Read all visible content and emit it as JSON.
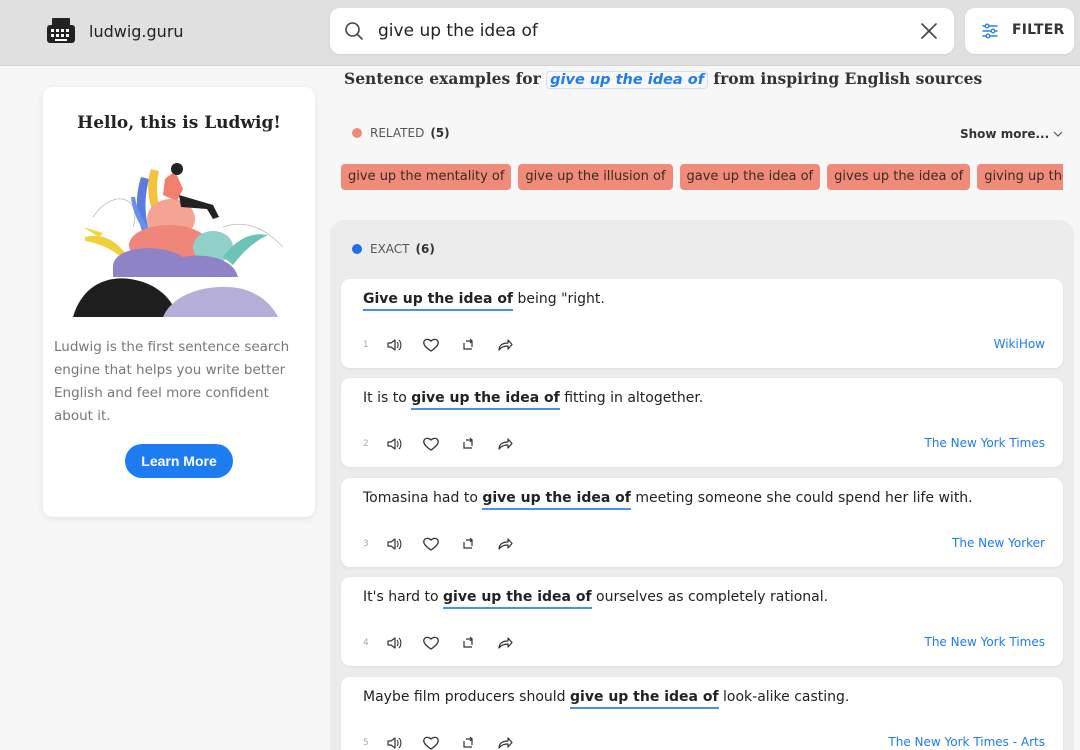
{
  "header": {
    "site_name": "ludwig.guru",
    "search_value": "give up the idea of",
    "filter_label": "FILTER"
  },
  "hello": {
    "title": "Hello, this is Ludwig!",
    "description": "Ludwig is the first sentence search engine that helps you write better English and feel more confident about it.",
    "button": "Learn More"
  },
  "heading": {
    "prefix": "Sentence examples for",
    "query": "give up the idea of",
    "suffix": "from inspiring English sources"
  },
  "related": {
    "label": "RELATED",
    "count": "(5)",
    "show_more": "Show more...",
    "dot_color": "#f08b7a",
    "chips": [
      "give up the mentality of",
      "give up the illusion of",
      "gave up the idea of",
      "gives up the idea of",
      "giving up the idea of"
    ]
  },
  "exact": {
    "label": "EXACT",
    "count": "(6)",
    "dot_color": "#1e6fe8",
    "results": [
      {
        "num": "1",
        "before": "",
        "match": "Give up the idea of",
        "after": " being \"right.",
        "source": "WikiHow"
      },
      {
        "num": "2",
        "before": "It is to ",
        "match": "give up the idea of",
        "after": " fitting in altogether.",
        "source": "The New York Times"
      },
      {
        "num": "3",
        "before": "Tomasina had to ",
        "match": "give up the idea of",
        "after": " meeting someone she could spend her life with.",
        "source": "The New Yorker"
      },
      {
        "num": "4",
        "before": "It's hard to ",
        "match": "give up the idea of",
        "after": " ourselves as completely rational.",
        "source": "The New York Times"
      },
      {
        "num": "5",
        "before": "Maybe film producers should ",
        "match": "give up the idea of",
        "after": " look-alike casting.",
        "source": "The New York Times - Arts"
      }
    ]
  }
}
